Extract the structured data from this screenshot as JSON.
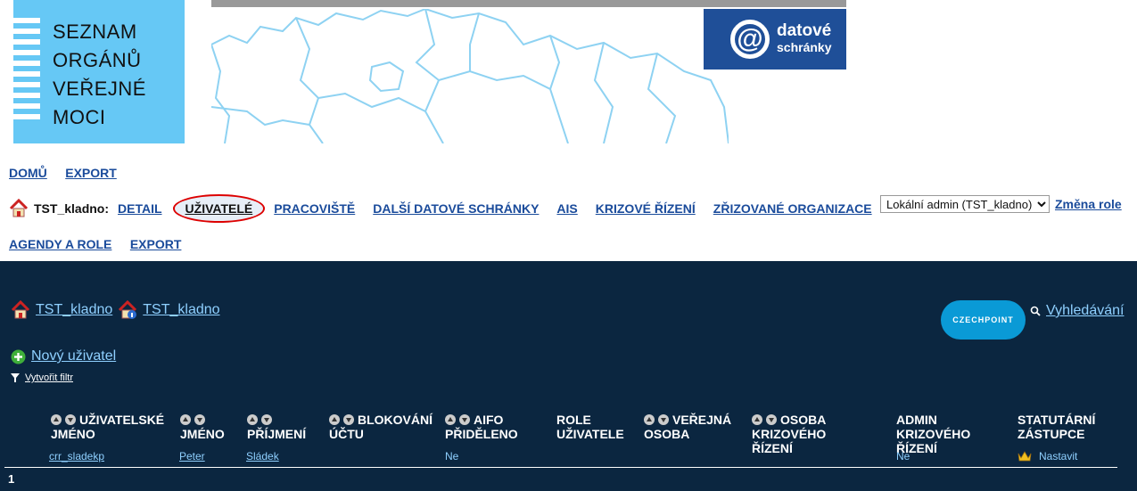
{
  "header": {
    "logo_lines": [
      "SEZNAM",
      "ORGÁNŮ",
      "VEŘEJNÉ",
      "MOCI"
    ],
    "ds_logo": {
      "line1": "datové",
      "line2": "schránky"
    }
  },
  "nav_top": {
    "home": "DOMŮ",
    "export": "EXPORT"
  },
  "nav_org": {
    "org_name": "TST_kladno:",
    "items": [
      "DETAIL",
      "UŽIVATELÉ",
      "PRACOVIŠTĚ",
      "DALŠÍ DATOVÉ SCHRÁNKY",
      "AIS",
      "KRIZOVÉ ŘÍZENÍ",
      "ZŘIZOVANÉ ORGANIZACE"
    ],
    "active": "UŽIVATELÉ"
  },
  "nav_bottom": {
    "agendas": "AGENDY A ROLE",
    "export": "EXPORT"
  },
  "role": {
    "selected": "Lokální admin (TST_kladno)",
    "change_label": "Změna role"
  },
  "breadcrumbs": [
    "TST_kladno",
    "TST_kladno"
  ],
  "czechpoint": {
    "part1": "CZECH",
    "part2": "POINT"
  },
  "search_label": "Vyhledávání",
  "new_user_label": "Nový uživatel",
  "filter_label": "Vytvořit filtr",
  "table": {
    "headers": [
      "UŽIVATELSKÉ JMÉNO",
      "JMÉNO",
      "PŘÍJMENÍ",
      "BLOKOVÁNÍ ÚČTU",
      "AIFO PŘIDĚLENO",
      "ROLE UŽIVATELE",
      "VEŘEJNÁ OSOBA",
      "OSOBA KRIZOVÉHO ŘÍZENÍ",
      "ADMIN KRIZOVÉHO ŘÍZENÍ",
      "STATUTÁRNÍ ZÁSTUPCE"
    ],
    "rows": [
      {
        "username": "crr_sladekp",
        "first_name": "Peter",
        "last_name": "Sládek",
        "aifo": "Ne",
        "admin_crisis": "Ne",
        "statutory": "Nastavit"
      }
    ]
  },
  "pager": {
    "page": "1"
  },
  "colors": {
    "dark_bg": "#0b2640",
    "link_light": "#8fd0ff",
    "nav_link": "#1a4b9b",
    "logo_blue": "#66c8f5"
  }
}
